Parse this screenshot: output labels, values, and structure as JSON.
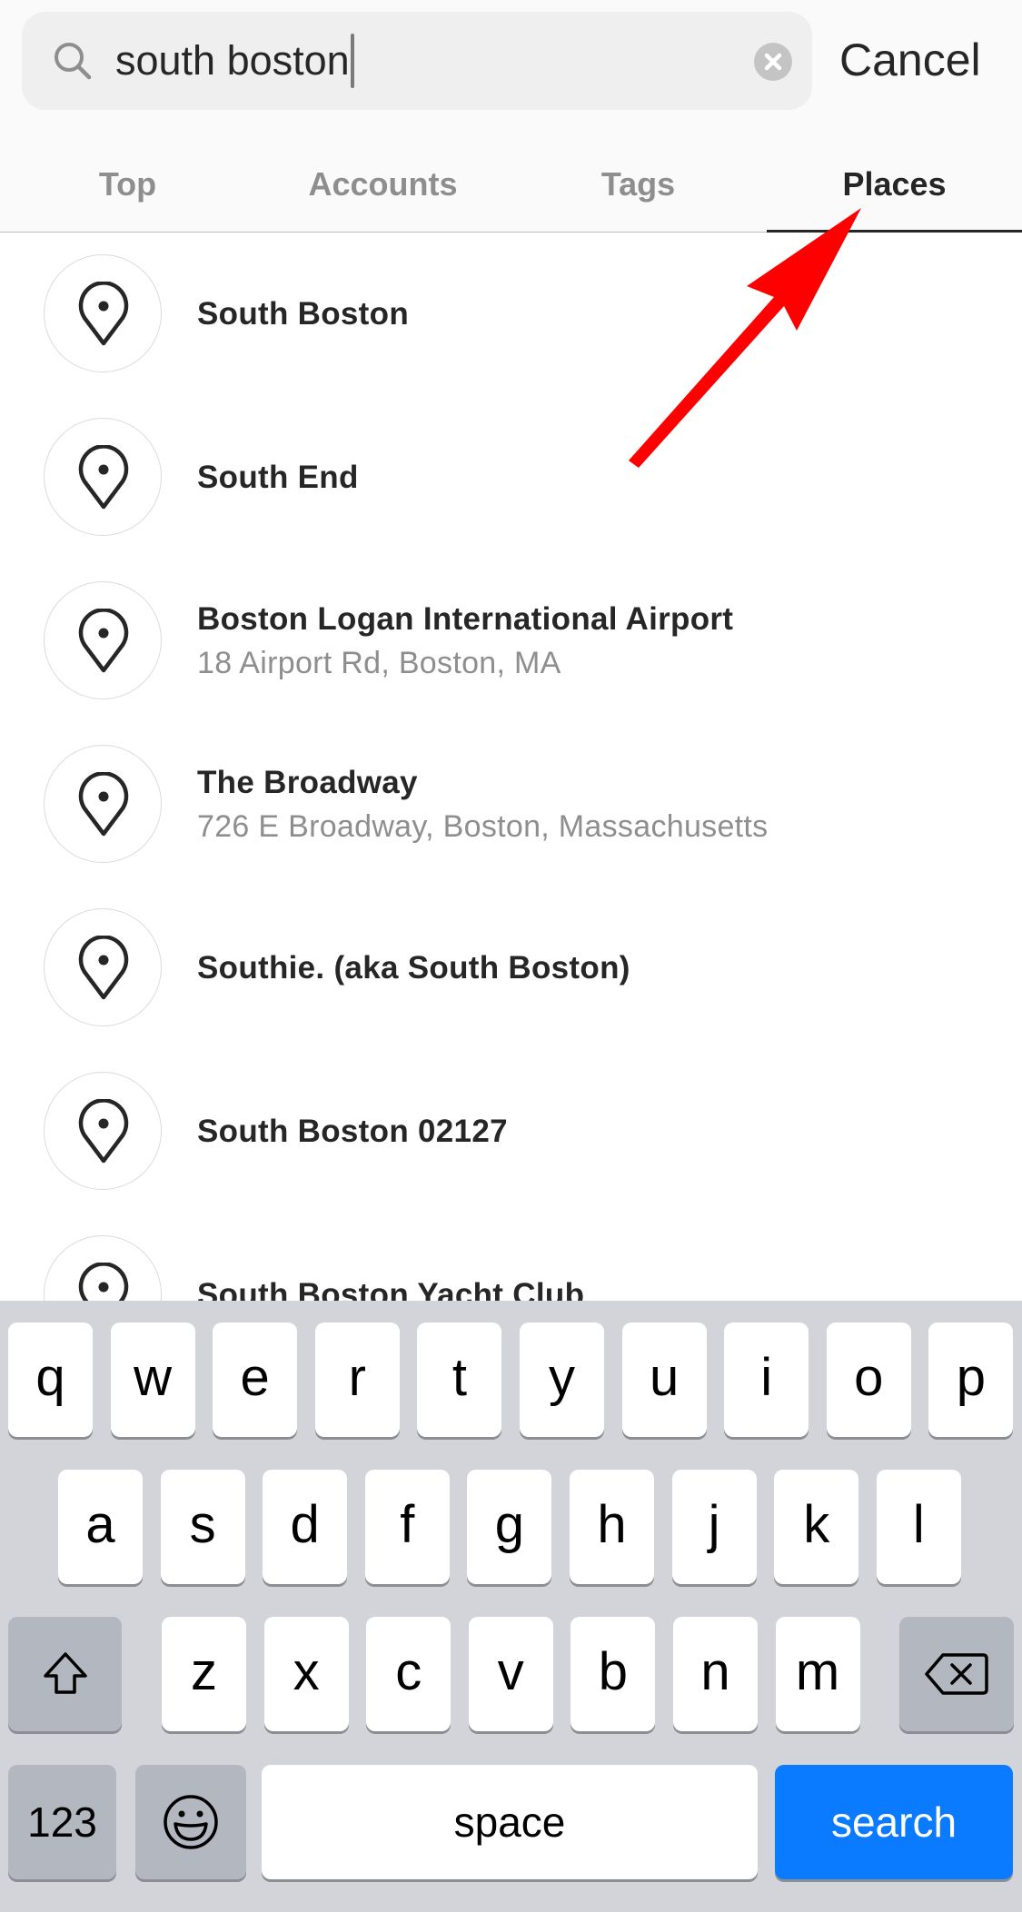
{
  "search": {
    "query": "south boston",
    "cancel_label": "Cancel",
    "icon": "search-icon",
    "clear_icon": "clear-icon"
  },
  "tabs": [
    {
      "label": "Top",
      "active": false
    },
    {
      "label": "Accounts",
      "active": false
    },
    {
      "label": "Tags",
      "active": false
    },
    {
      "label": "Places",
      "active": true
    }
  ],
  "results": [
    {
      "title": "South Boston",
      "subtitle": "",
      "icon": "location-pin-icon"
    },
    {
      "title": "South End",
      "subtitle": "",
      "icon": "location-pin-icon"
    },
    {
      "title": "Boston Logan International Airport",
      "subtitle": "18 Airport Rd, Boston, MA",
      "icon": "location-pin-icon"
    },
    {
      "title": "The Broadway",
      "subtitle": "726 E Broadway, Boston, Massachusetts",
      "icon": "location-pin-icon"
    },
    {
      "title": "Southie.  (aka South Boston)",
      "subtitle": "",
      "icon": "location-pin-icon"
    },
    {
      "title": "South Boston 02127",
      "subtitle": "",
      "icon": "location-pin-icon"
    },
    {
      "title": "South Boston Yacht Club",
      "subtitle": "",
      "icon": "location-pin-icon"
    }
  ],
  "annotation": {
    "type": "arrow",
    "color": "#ff0000",
    "points_to": "Places tab"
  },
  "keyboard": {
    "row1": [
      "q",
      "w",
      "e",
      "r",
      "t",
      "y",
      "u",
      "i",
      "o",
      "p"
    ],
    "row2": [
      "a",
      "s",
      "d",
      "f",
      "g",
      "h",
      "j",
      "k",
      "l"
    ],
    "row3": [
      "z",
      "x",
      "c",
      "v",
      "b",
      "n",
      "m"
    ],
    "shift_icon": "shift-icon",
    "delete_icon": "delete-icon",
    "numbers_label": "123",
    "emoji_icon": "emoji-icon",
    "space_label": "space",
    "action_label": "search",
    "action_color": "#0a7aff"
  }
}
